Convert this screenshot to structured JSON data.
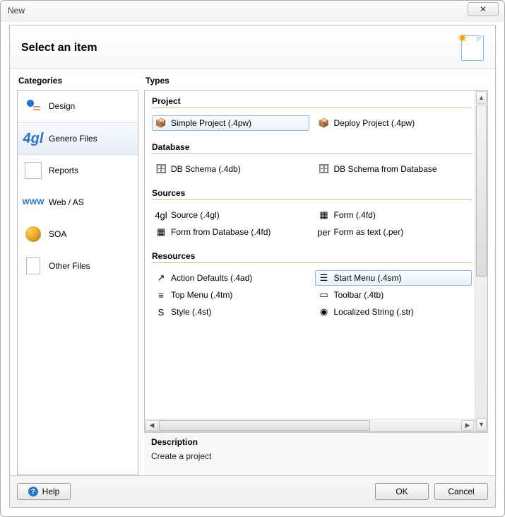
{
  "window": {
    "title": "New"
  },
  "header": {
    "title": "Select an item"
  },
  "panel_labels": {
    "categories": "Categories",
    "types": "Types"
  },
  "categories": [
    {
      "label": "Design",
      "icon": "design-icon",
      "selected": false
    },
    {
      "label": "Genero Files",
      "icon": "genero-files-icon",
      "selected": true
    },
    {
      "label": "Reports",
      "icon": "reports-icon",
      "selected": false
    },
    {
      "label": "Web / AS",
      "icon": "web-as-icon",
      "selected": false
    },
    {
      "label": "SOA",
      "icon": "soa-icon",
      "selected": false
    },
    {
      "label": "Other Files",
      "icon": "other-files-icon",
      "selected": false
    }
  ],
  "groups": [
    {
      "title": "Project",
      "items": [
        {
          "label": "Simple Project (.4pw)",
          "icon": "cube-icon",
          "selected": true
        },
        {
          "label": "Deploy Project (.4pw)",
          "icon": "cube-icon",
          "selected": false
        }
      ]
    },
    {
      "title": "Database",
      "items": [
        {
          "label": "DB Schema (.4db)",
          "icon": "db-icon",
          "selected": false
        },
        {
          "label": "DB Schema from Database",
          "icon": "db-icon",
          "selected": false
        }
      ]
    },
    {
      "title": "Sources",
      "items": [
        {
          "label": "Source (.4gl)",
          "icon": "source-icon",
          "selected": false
        },
        {
          "label": "Form (.4fd)",
          "icon": "form-icon",
          "selected": false
        },
        {
          "label": "Form from Database (.4fd)",
          "icon": "form-db-icon",
          "selected": false
        },
        {
          "label": "Form as text (.per)",
          "icon": "per-icon",
          "selected": false
        }
      ]
    },
    {
      "title": "Resources",
      "items": [
        {
          "label": "Action Defaults (.4ad)",
          "icon": "action-icon",
          "selected": false
        },
        {
          "label": "Start Menu (.4sm)",
          "icon": "startmenu-icon",
          "selected": true
        },
        {
          "label": "Top Menu (.4tm)",
          "icon": "topmenu-icon",
          "selected": false
        },
        {
          "label": "Toolbar (.4tb)",
          "icon": "toolbar-icon",
          "selected": false
        },
        {
          "label": "Style (.4st)",
          "icon": "style-icon",
          "selected": false
        },
        {
          "label": "Localized String (.str)",
          "icon": "string-icon",
          "selected": false
        }
      ]
    }
  ],
  "description": {
    "label": "Description",
    "text": "Create a project"
  },
  "buttons": {
    "help": "Help",
    "ok": "OK",
    "cancel": "Cancel"
  },
  "icons": {
    "design-icon": "",
    "genero-files-icon": "4gl",
    "reports-icon": "",
    "web-as-icon": "WWW",
    "soa-icon": "",
    "other-files-icon": "",
    "cube-icon": "📦",
    "db-icon": "🗄",
    "source-icon": "4gl",
    "form-icon": "▦",
    "form-db-icon": "▦",
    "per-icon": "per",
    "action-icon": "↗",
    "startmenu-icon": "☰",
    "topmenu-icon": "≡",
    "toolbar-icon": "▭",
    "style-icon": "S",
    "string-icon": "◉",
    "close": "✕",
    "spark": "✷"
  }
}
